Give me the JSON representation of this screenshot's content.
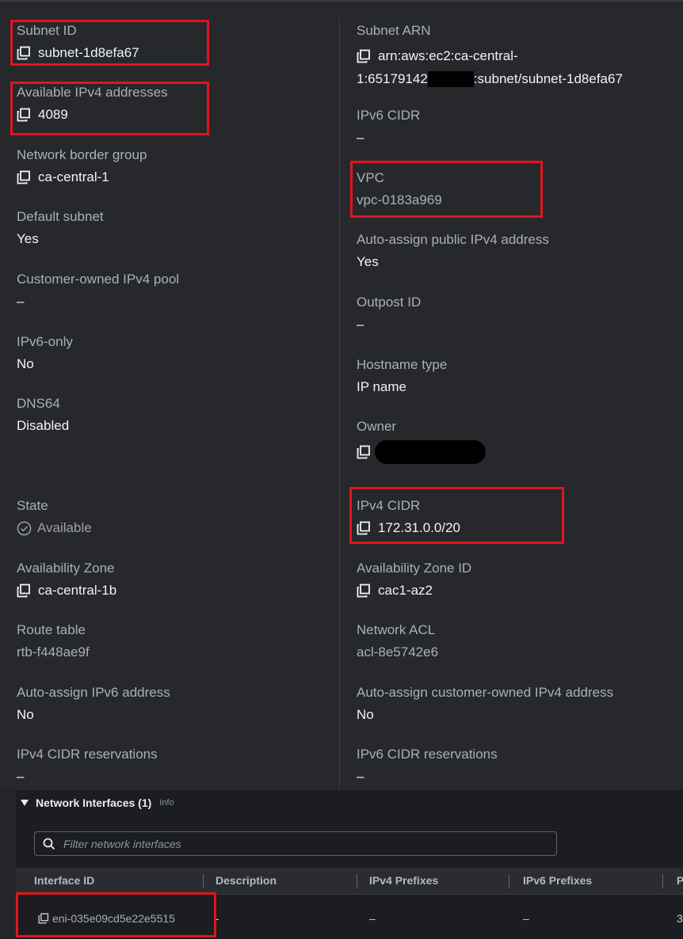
{
  "details": {
    "left": [
      {
        "label": "Subnet ID",
        "value": "subnet-1d8efa67"
      },
      {
        "label": "Available IPv4 addresses",
        "value": "4089"
      },
      {
        "label": "Network border group",
        "value": "ca-central-1"
      },
      {
        "label": "Default subnet",
        "value": "Yes"
      },
      {
        "label": "Customer-owned IPv4 pool",
        "value": "–"
      },
      {
        "label": "IPv6-only",
        "value": "No"
      },
      {
        "label": "DNS64",
        "value": "Disabled"
      },
      {
        "label": "State",
        "value": "Available"
      },
      {
        "label": "Availability Zone",
        "value": "ca-central-1b"
      },
      {
        "label": "Route table",
        "value": "rtb-f448ae9f"
      },
      {
        "label": "Auto-assign IPv6 address",
        "value": "No"
      },
      {
        "label": "IPv4 CIDR reservations",
        "value": "–"
      }
    ],
    "right": [
      {
        "label": "Subnet ARN",
        "value_line1_a": "arn:aws:ec2:ca-central-",
        "value_line2_a": "1:65179142",
        "value_line2_b": ":subnet/subnet-1d8efa67"
      },
      {
        "label": "IPv6 CIDR",
        "value": "–"
      },
      {
        "label": "VPC",
        "value": "vpc-0183a969"
      },
      {
        "label": "Auto-assign public IPv4 address",
        "value": "Yes"
      },
      {
        "label": "Outpost ID",
        "value": "–"
      },
      {
        "label": "Hostname type",
        "value": "IP name"
      },
      {
        "label": "Owner",
        "value": ""
      },
      {
        "label": "IPv4 CIDR",
        "value": "172.31.0.0/20"
      },
      {
        "label": "Availability Zone ID",
        "value": "cac1-az2"
      },
      {
        "label": "Network ACL",
        "value": "acl-8e5742e6"
      },
      {
        "label": "Auto-assign customer-owned IPv4 address",
        "value": "No"
      },
      {
        "label": "IPv6 CIDR reservations",
        "value": "–"
      }
    ]
  },
  "network_interfaces": {
    "title": "Network Interfaces (1)",
    "info": "Info",
    "search_placeholder": "Filter network interfaces",
    "columns": [
      "Interface ID",
      "Description",
      "IPv4 Prefixes",
      "IPv6 Prefixes",
      "P"
    ],
    "rows": [
      {
        "interface_id": "eni-035e09cd5e22e5515",
        "description": "-",
        "ipv4_prefixes": "–",
        "ipv6_prefixes": "–",
        "p": "3"
      }
    ]
  },
  "colors": {
    "highlight": "#e0151c",
    "background": "#26282c"
  },
  "icons": {
    "copy": "copy-icon",
    "status": "check-circle-icon",
    "search": "search-icon",
    "expand": "caret-down-icon"
  }
}
